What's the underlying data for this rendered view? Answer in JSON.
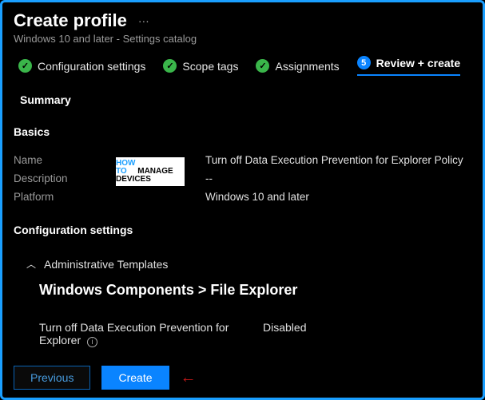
{
  "header": {
    "title": "Create profile",
    "subtitle": "Windows 10 and later - Settings catalog"
  },
  "steps": {
    "s1": "Configuration settings",
    "s2": "Scope tags",
    "s3": "Assignments",
    "s4_num": "5",
    "s4": "Review + create"
  },
  "summary": {
    "heading": "Summary",
    "basics_heading": "Basics",
    "labels": {
      "name": "Name",
      "description": "Description",
      "platform": "Platform"
    },
    "values": {
      "name": "Turn off Data Execution Prevention for Explorer Policy",
      "description": "--",
      "platform": "Windows 10 and later"
    }
  },
  "config": {
    "heading": "Configuration settings",
    "group": "Administrative Templates",
    "breadcrumb": "Windows Components > File Explorer",
    "setting_label": "Turn off Data Execution Prevention for Explorer",
    "setting_value": "Disabled"
  },
  "footer": {
    "previous": "Previous",
    "create": "Create"
  },
  "watermark": "MANAGE DEVICES"
}
